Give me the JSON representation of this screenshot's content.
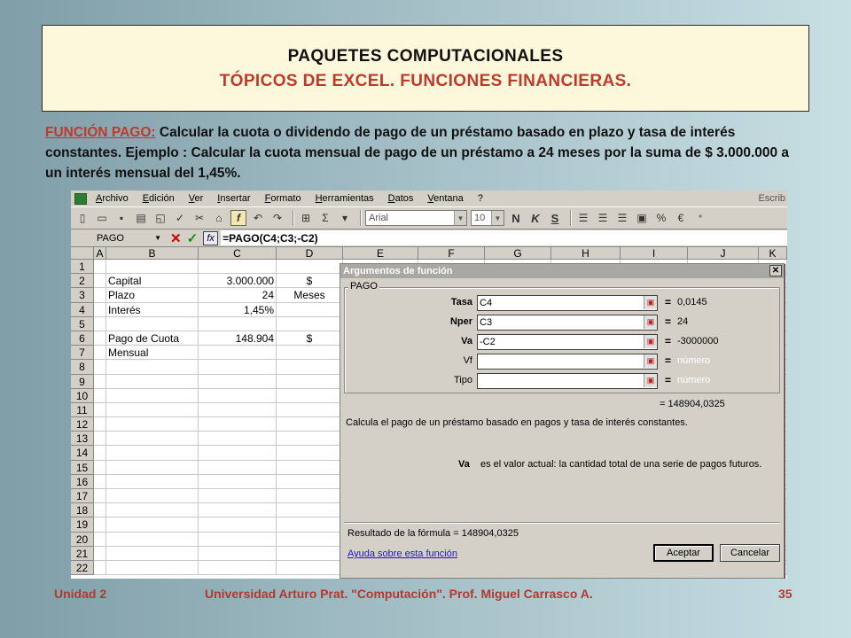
{
  "slide": {
    "title_line1": "PAQUETES COMPUTACIONALES",
    "title_line2": "TÓPICOS DE EXCEL. FUNCIONES FINANCIERAS.",
    "desc_label": "FUNCIÓN PAGO:",
    "desc_text": " Calcular la cuota o dividendo de pago de un préstamo basado en plazo y tasa de interés constantes. Ejemplo : Calcular la cuota mensual de pago de un préstamo a 24 meses por la suma de $ 3.000.000 a un interés mensual del 1,45%.",
    "footer_unit": "Unidad 2",
    "footer_center": "Universidad Arturo Prat.  \"Computación\".  Prof. Miguel Carrasco A.",
    "footer_page": "35"
  },
  "excel": {
    "menu": [
      "Archivo",
      "Edición",
      "Ver",
      "Insertar",
      "Formato",
      "Herramientas",
      "Datos",
      "Ventana",
      "?"
    ],
    "help_hint": "Escrib",
    "font_name": "Arial",
    "font_size": "10",
    "bold_label": "N",
    "italic_label": "K",
    "underline_label": "S",
    "namebox": "PAGO",
    "formula": "=PAGO(C4;C3;-C2)",
    "columns": [
      "A",
      "B",
      "C",
      "D",
      "E",
      "F",
      "G",
      "H",
      "I",
      "J",
      "K"
    ],
    "row_numbers": [
      "1",
      "2",
      "3",
      "4",
      "5",
      "6",
      "7",
      "8",
      "9",
      "10",
      "11",
      "12",
      "13",
      "14",
      "15",
      "16",
      "17",
      "18",
      "19",
      "20",
      "21",
      "22"
    ],
    "cells": {
      "b2": "Capital",
      "c2": "3.000.000",
      "d2": "$",
      "b3": "Plazo",
      "c3": "24",
      "d3": "Meses",
      "b4": "Interés",
      "c4": "1,45%",
      "b6": "Pago de Cuota",
      "c6": "148.904",
      "d6": "$",
      "b7": "Mensual"
    }
  },
  "dialog": {
    "title": "Argumentos de función",
    "close": "✕",
    "group_label": "PAGO",
    "args": [
      {
        "name": "Tasa",
        "value": "C4",
        "result": "0,0145",
        "required": true
      },
      {
        "name": "Nper",
        "value": "C3",
        "result": "24",
        "required": true
      },
      {
        "name": "Va",
        "value": "-C2",
        "result": "-3000000",
        "required": true
      },
      {
        "name": "Vf",
        "value": "",
        "result": "número",
        "required": false
      },
      {
        "name": "Tipo",
        "value": "",
        "result": "número",
        "required": false
      }
    ],
    "result_top": "=  148904,0325",
    "description": "Calcula el pago de un préstamo basado en pagos y tasa de interés constantes.",
    "arg_desc_name": "Va",
    "arg_desc_text": "es el valor actual: la cantidad total de una serie de pagos futuros.",
    "formula_result": "Resultado de la fórmula =   148904,0325",
    "help_link": "Ayuda sobre esta función",
    "ok": "Aceptar",
    "cancel": "Cancelar"
  }
}
